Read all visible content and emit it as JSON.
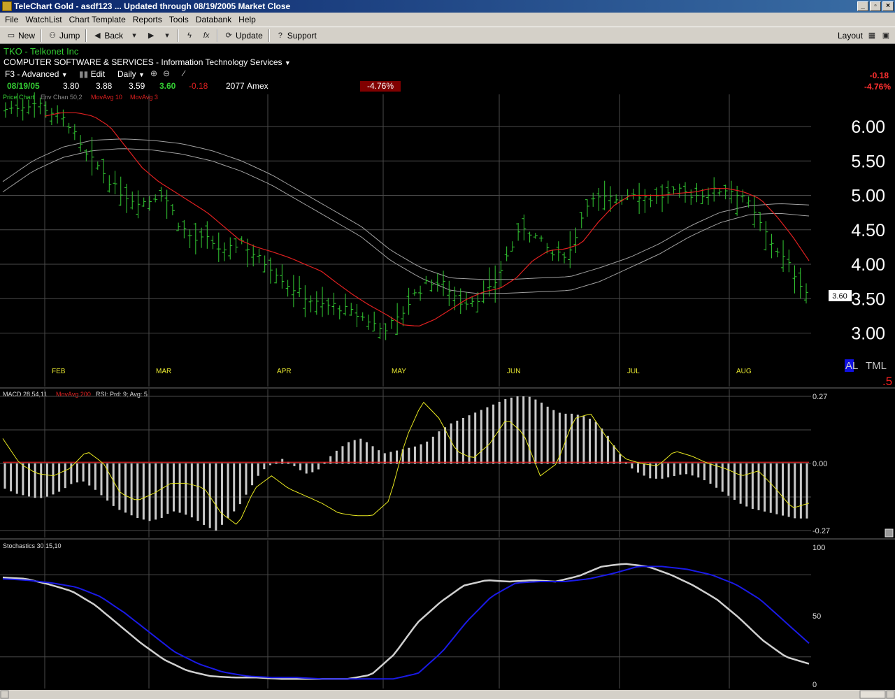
{
  "window": {
    "title": "TeleChart Gold - asdf123  ... Updated through 08/19/2005  Market Close",
    "minimize": "_",
    "maximize": "▫",
    "close": "×"
  },
  "menu": [
    "File",
    "WatchList",
    "Chart Template",
    "Reports",
    "Tools",
    "Databank",
    "Help"
  ],
  "toolbar": {
    "new": "New",
    "jump": "Jump",
    "back": "Back",
    "update": "Update",
    "support": "Support",
    "layout": "Layout"
  },
  "header": {
    "symbol_line": "TKO - Telkonet Inc",
    "sector_line": "COMPUTER SOFTWARE & SERVICES - Information Technology Services",
    "template": "F3 - Advanced",
    "edit": "Edit",
    "period": "Daily",
    "date": "08/19/05",
    "open": "3.80",
    "high": "3.88",
    "low": "3.59",
    "close": "3.60",
    "change": "-0.18",
    "volume": "2077",
    "exchange": "Amex",
    "pct_change": "-4.76%",
    "right_change": "-0.18",
    "right_pct": "-4.76%"
  },
  "legends": {
    "price": [
      "Price Chart",
      "Env Chan 50,2",
      "MovAvg 10",
      "MovAvg 3"
    ],
    "macd": [
      "MACD 28,54,11",
      "MovAvg 200",
      "RSI: Prd: 9; Avg: 5"
    ],
    "stoch": "Stochastics 30,15,10"
  },
  "colors": {
    "price_bar": "#33cc33",
    "ma": "#e02020",
    "envelope": "#a0a0a0",
    "macd_hist": "#c8c8c8",
    "rsi": "#e8e820",
    "stoch_fast": "#d0d0d0",
    "stoch_slow": "#1a1ae6",
    "grid": "#4a4a4a",
    "month": "#e8e830"
  },
  "price_marker": "3.60",
  "right_labels": {
    "al": "AL",
    "tml": "TML",
    "five": ".5"
  },
  "chart_data": [
    {
      "type": "bar",
      "panel": "price",
      "y_ticks": [
        "6.00",
        "5.50",
        "5.00",
        "4.50",
        "4.00",
        "3.50",
        "3.00"
      ],
      "months": [
        "FEB",
        "MAR",
        "APR",
        "MAY",
        "JUN",
        "JUL",
        "AUG"
      ],
      "close_path": [
        6.25,
        6.3,
        6.35,
        6.2,
        6.05,
        5.6,
        5.4,
        5.1,
        4.95,
        4.9,
        5.05,
        4.6,
        4.35,
        4.35,
        4.15,
        4.35,
        4.1,
        3.95,
        3.7,
        3.55,
        3.4,
        3.4,
        3.3,
        3.2,
        3.05,
        3.2,
        3.55,
        3.75,
        3.7,
        3.45,
        3.5,
        3.65,
        4.15,
        4.55,
        4.35,
        4.1,
        4.2,
        4.9,
        4.95,
        4.95,
        5.05,
        4.95,
        5.0,
        5.05,
        5.0,
        5.05,
        5.1,
        5.0,
        4.6,
        4.25,
        3.95,
        3.6
      ],
      "ma10_path": [
        6.15,
        6.2,
        6.2,
        6.15,
        6.0,
        5.7,
        5.4,
        5.2,
        5.05,
        4.9,
        4.75,
        4.55,
        4.35,
        4.25,
        4.18,
        4.1,
        4.0,
        3.9,
        3.72,
        3.55,
        3.4,
        3.27,
        3.12,
        3.1,
        3.2,
        3.35,
        3.5,
        3.6,
        3.65,
        3.8,
        4.05,
        4.2,
        4.22,
        4.3,
        4.6,
        4.85,
        5.0,
        5.0,
        5.0,
        5.03,
        5.05,
        5.1,
        5.1,
        5.05,
        4.95,
        4.7,
        4.4,
        4.05
      ],
      "env_upper": [
        5.2,
        5.5,
        5.7,
        5.8,
        5.82,
        5.8,
        5.75,
        5.65,
        5.5,
        5.3,
        5.05,
        4.8,
        4.55,
        4.2,
        3.95,
        3.8,
        3.78,
        3.78,
        3.8,
        3.82,
        3.95,
        4.1,
        4.3,
        4.55,
        4.75,
        4.85,
        4.88,
        4.86
      ],
      "env_lower": [
        5.05,
        5.35,
        5.55,
        5.65,
        5.68,
        5.66,
        5.6,
        5.5,
        5.35,
        5.15,
        4.9,
        4.65,
        4.4,
        4.05,
        3.8,
        3.62,
        3.57,
        3.58,
        3.6,
        3.62,
        3.75,
        3.95,
        4.15,
        4.4,
        4.6,
        4.72,
        4.74,
        4.7
      ]
    },
    {
      "type": "bar",
      "panel": "macd",
      "y_ticks": [
        "0.27",
        "0.00",
        "-0.27"
      ],
      "hist": [
        -0.1,
        -0.12,
        -0.13,
        -0.14,
        -0.13,
        -0.11,
        -0.08,
        -0.07,
        -0.1,
        -0.14,
        -0.18,
        -0.2,
        -0.22,
        -0.23,
        -0.22,
        -0.19,
        -0.2,
        -0.22,
        -0.25,
        -0.27,
        -0.22,
        -0.17,
        -0.1,
        -0.03,
        0.0,
        0.02,
        -0.01,
        -0.04,
        -0.03,
        0.02,
        0.06,
        0.09,
        0.1,
        0.07,
        0.04,
        0.05,
        0.06,
        0.07,
        0.09,
        0.13,
        0.16,
        0.18,
        0.2,
        0.22,
        0.24,
        0.26,
        0.27,
        0.27,
        0.25,
        0.22,
        0.2,
        0.2,
        0.19,
        0.17,
        0.12,
        0.05,
        -0.01,
        -0.04,
        -0.06,
        -0.06,
        -0.05,
        -0.04,
        -0.05,
        -0.07,
        -0.1,
        -0.13,
        -0.16,
        -0.18,
        -0.19,
        -0.2,
        -0.21,
        -0.22,
        -0.22
      ],
      "rsi": [
        0.1,
        0.0,
        -0.04,
        -0.05,
        -0.02,
        0.05,
        0.0,
        -0.12,
        -0.15,
        -0.12,
        -0.08,
        -0.08,
        -0.1,
        -0.2,
        -0.25,
        -0.1,
        -0.05,
        -0.1,
        -0.13,
        -0.16,
        -0.2,
        -0.21,
        -0.21,
        -0.15,
        0.1,
        0.25,
        0.18,
        0.05,
        0.02,
        0.08,
        0.18,
        0.12,
        -0.05,
        0.0,
        0.18,
        0.2,
        0.1,
        0.02,
        0.0,
        -0.01,
        0.05,
        0.03,
        0.0,
        -0.02,
        -0.05,
        -0.03,
        -0.1,
        -0.18,
        -0.16
      ]
    },
    {
      "type": "line",
      "panel": "stoch",
      "y_ticks": [
        "100",
        "50",
        "0"
      ],
      "fast": [
        78,
        77,
        73,
        68,
        58,
        44,
        30,
        18,
        10,
        6,
        5,
        5,
        4,
        4,
        4,
        4,
        7,
        22,
        45,
        60,
        72,
        76,
        75,
        76,
        75,
        79,
        86,
        88,
        86,
        80,
        72,
        62,
        48,
        32,
        20,
        15
      ],
      "slow": [
        77,
        76,
        74,
        71,
        64,
        52,
        38,
        24,
        15,
        9,
        6,
        5,
        5,
        4,
        4,
        4,
        4,
        8,
        24,
        46,
        64,
        74,
        75,
        75,
        77,
        81,
        86,
        86,
        84,
        80,
        73,
        62,
        46,
        30
      ]
    }
  ]
}
